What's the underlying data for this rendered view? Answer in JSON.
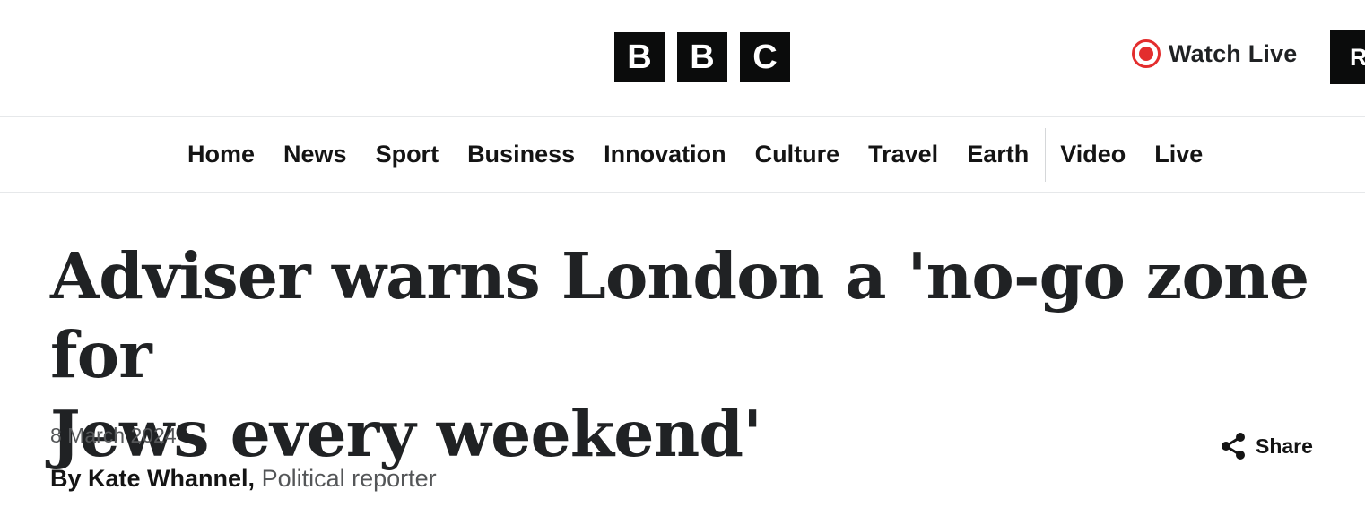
{
  "header": {
    "logo_letters": [
      "B",
      "B",
      "C"
    ],
    "watch_live_label": "Watch Live",
    "register_label": "R",
    "live_color": "#e32d2d"
  },
  "nav": {
    "items": [
      "Home",
      "News",
      "Sport",
      "Business",
      "Innovation",
      "Culture",
      "Travel",
      "Earth"
    ],
    "extra_items": [
      "Video",
      "Live"
    ]
  },
  "article": {
    "headline_line1": "Adviser warns London a 'no-go zone for",
    "headline_line2": "Jews every weekend'",
    "date": "8 March 2024",
    "author": "By Kate Whannel,",
    "role": "Political reporter",
    "share_label": "Share"
  }
}
